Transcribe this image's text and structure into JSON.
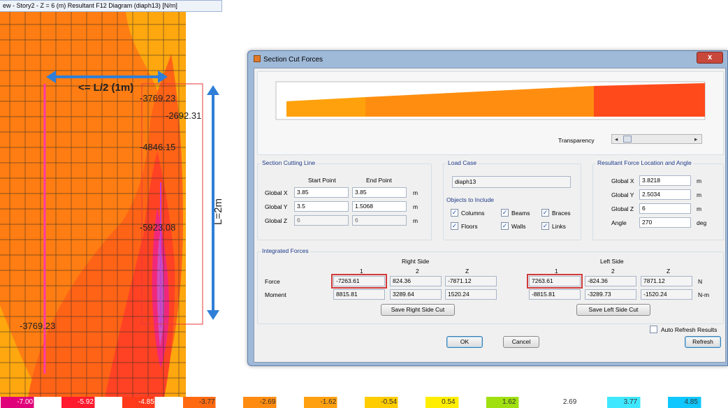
{
  "window": {
    "tab_title": "ew - Story2 - Z = 6 (m)   Resultant F12 Diagram    (diaph13)  [N/m]"
  },
  "plot_labels": [
    "-3769.23",
    "-2692.31",
    "-4846.15",
    "-5923.08",
    "-3769.23"
  ],
  "annotations": {
    "half_length": "<= L/2 (1m)",
    "length": "L=2m"
  },
  "legend": {
    "values": [
      "-7.00",
      "-5.92",
      "-4.85",
      "-3.77",
      "-2.69",
      "-1.62",
      "-0.54",
      "0.54",
      "1.62",
      "2.69",
      "3.77",
      "4.85"
    ],
    "colors": [
      "#e0007a",
      "#ff1a2e",
      "#ff3a1a",
      "#ff6a10",
      "#ff8c10",
      "#ffa010",
      "#ffcc00",
      "#ffee00",
      "#a0e010",
      "#ffffff",
      "#40e8ff",
      "#10c8ff"
    ]
  },
  "dialog": {
    "title": "Section Cut Forces",
    "close_label": "x",
    "transparency_label": "Transparency",
    "section_cutting_line": {
      "label": "Section Cutting Line",
      "start_header": "Start Point",
      "end_header": "End Point",
      "rows": [
        {
          "label": "Global X",
          "start": "3.85",
          "end": "3.85",
          "unit": "m"
        },
        {
          "label": "Global Y",
          "start": "3.5",
          "end": "1.5068",
          "unit": "m"
        },
        {
          "label": "Global Z",
          "start": "6",
          "end": "6",
          "unit": "m"
        }
      ]
    },
    "load_case": {
      "label": "Load Case",
      "value": "diaph13"
    },
    "objects": {
      "label": "Objects to Include",
      "items": [
        "Columns",
        "Beams",
        "Braces",
        "Floors",
        "Walls",
        "Links"
      ]
    },
    "resultant": {
      "label": "Resultant Force Location and Angle",
      "rows": [
        {
          "label": "Global X",
          "value": "3.8218",
          "unit": "m"
        },
        {
          "label": "Global Y",
          "value": "2.5034",
          "unit": "m"
        },
        {
          "label": "Global Z",
          "value": "6",
          "unit": "m"
        },
        {
          "label": "Angle",
          "value": "270",
          "unit": "deg"
        }
      ]
    },
    "integrated": {
      "label": "Integrated Forces",
      "right_side": "Right Side",
      "left_side": "Left Side",
      "cols": [
        "1",
        "2",
        "Z"
      ],
      "force_label": "Force",
      "moment_label": "Moment",
      "right_force": [
        "-7263.61",
        "824.36",
        "-7871.12"
      ],
      "right_moment": [
        "8815.81",
        "3289.64",
        "1520.24"
      ],
      "left_force": [
        "7263.61",
        "-824.36",
        "7871.12"
      ],
      "left_moment": [
        "-8815.81",
        "-3289.73",
        "-1520.24"
      ],
      "force_unit": "N",
      "moment_unit": "N-m",
      "save_right": "Save Right Side Cut",
      "save_left": "Save Left Side Cut"
    },
    "auto_refresh": "Auto Refresh Results",
    "refresh": "Refresh",
    "ok": "OK",
    "cancel": "Cancel"
  }
}
